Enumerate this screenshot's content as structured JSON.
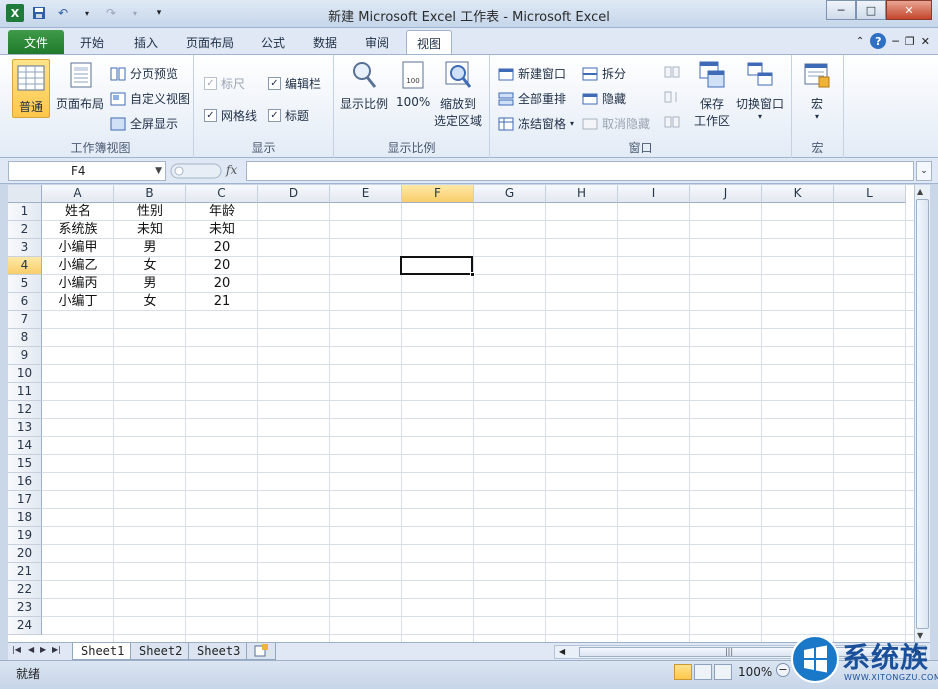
{
  "window": {
    "title": "新建 Microsoft Excel 工作表 - Microsoft Excel"
  },
  "tabs": [
    {
      "label": "文件",
      "kind": "file"
    },
    {
      "label": "开始"
    },
    {
      "label": "插入"
    },
    {
      "label": "页面布局"
    },
    {
      "label": "公式"
    },
    {
      "label": "数据"
    },
    {
      "label": "审阅"
    },
    {
      "label": "视图",
      "active": true
    }
  ],
  "ribbon": {
    "workbook_views": {
      "label": "工作簿视图",
      "normal": "普通",
      "page_layout": "页面布局",
      "page_break": "分页预览",
      "custom_views": "自定义视图",
      "full_screen": "全屏显示"
    },
    "show": {
      "label": "显示",
      "ruler": "标尺",
      "gridlines": "网格线",
      "formula_bar": "编辑栏",
      "headings": "标题"
    },
    "zoom": {
      "label": "显示比例",
      "zoom": "显示比例",
      "hundred": "100%",
      "zoom_to_selection_1": "缩放到",
      "zoom_to_selection_2": "选定区域"
    },
    "window": {
      "label": "窗口",
      "new_window": "新建窗口",
      "arrange_all": "全部重排",
      "freeze_panes": "冻结窗格",
      "split": "拆分",
      "hide": "隐藏",
      "unhide": "取消隐藏",
      "save_workspace_1": "保存",
      "save_workspace_2": "工作区",
      "switch_windows": "切换窗口"
    },
    "macros": {
      "label": "宏",
      "macros": "宏"
    }
  },
  "formula_bar": {
    "name_box": "F4",
    "fx": "fx",
    "value": ""
  },
  "grid": {
    "columns": [
      "A",
      "B",
      "C",
      "D",
      "E",
      "F",
      "G",
      "H",
      "I",
      "J",
      "K",
      "L"
    ],
    "selected_column": "F",
    "rows": [
      "1",
      "2",
      "3",
      "4",
      "5",
      "6",
      "7",
      "8",
      "9",
      "10",
      "11",
      "12",
      "13",
      "14",
      "15",
      "16",
      "17",
      "18",
      "19",
      "20",
      "21",
      "22",
      "23",
      "24"
    ],
    "selected_row": "4",
    "cells": [
      [
        "姓名",
        "性别",
        "年龄"
      ],
      [
        "系统族",
        "未知",
        "未知"
      ],
      [
        "小编甲",
        "男",
        "20"
      ],
      [
        "小编乙",
        "女",
        "20"
      ],
      [
        "小编丙",
        "男",
        "20"
      ],
      [
        "小编丁",
        "女",
        "21"
      ]
    ]
  },
  "sheets": [
    {
      "name": "Sheet1",
      "active": true
    },
    {
      "name": "Sheet2"
    },
    {
      "name": "Sheet3"
    }
  ],
  "status": {
    "text": "就绪",
    "zoom": "100%"
  },
  "watermark": {
    "text": "系统族",
    "sub": "WWW.XITONGZU.COM"
  },
  "colors": {
    "accent": "#1e7b3a",
    "selection": "#f8cd6a"
  }
}
